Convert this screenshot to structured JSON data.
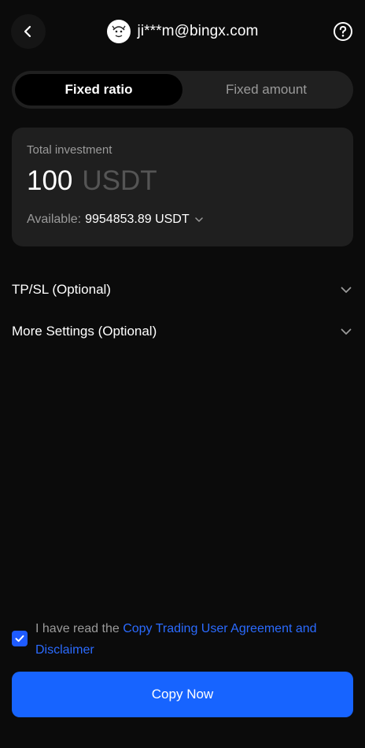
{
  "header": {
    "account": "ji***m@bingx.com"
  },
  "tabs": [
    {
      "label": "Fixed ratio",
      "active": true
    },
    {
      "label": "Fixed amount",
      "active": false
    }
  ],
  "investment": {
    "label": "Total investment",
    "amount": "100",
    "unit": "USDT",
    "available_label": "Available:",
    "available_value": "9954853.89 USDT"
  },
  "sections": {
    "tpsl": "TP/SL (Optional)",
    "more": "More Settings (Optional)"
  },
  "agreement": {
    "prefix": "I have read the ",
    "link": "Copy Trading User Agreement and Disclaimer",
    "checked": true
  },
  "action": {
    "copy_label": "Copy Now"
  },
  "colors": {
    "accent": "#1764ff",
    "background": "#0b0b0b",
    "card": "#1f1f1f"
  }
}
